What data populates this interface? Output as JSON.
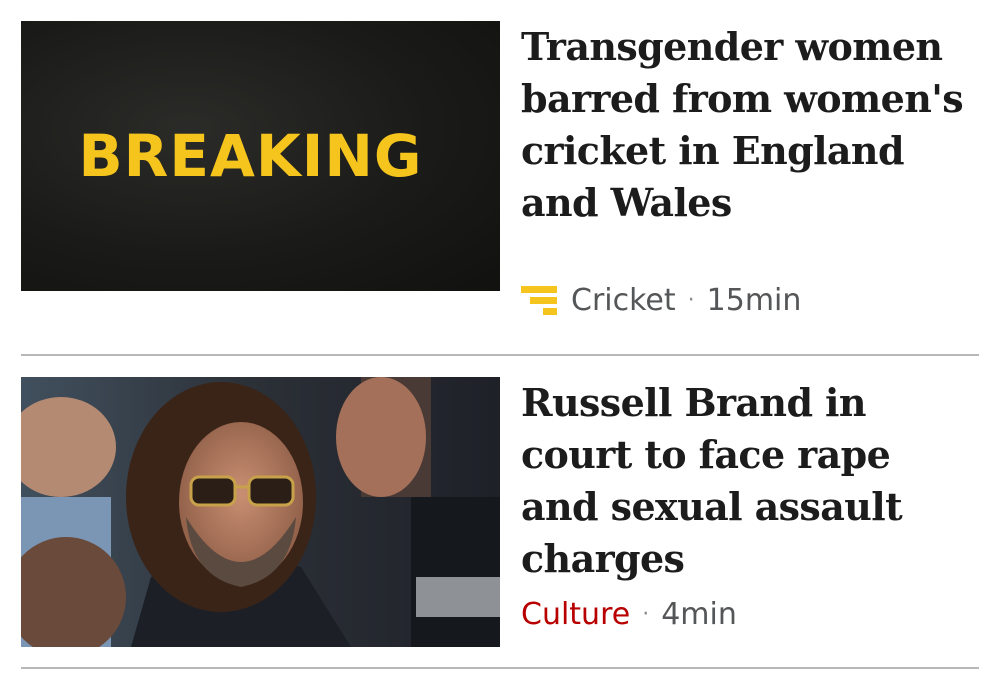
{
  "stories": [
    {
      "thumbnail_text": "BREAKING",
      "headline": "Transgender women barred from women's cricket in England and Wales",
      "section": "Cricket",
      "section_icon": "sport-icon",
      "separator": "·",
      "time": "15min"
    },
    {
      "headline": "Russell Brand in court to face rape and sexual assault charges",
      "section": "Culture",
      "separator": "·",
      "time": "4min"
    }
  ],
  "colors": {
    "breaking_yellow": "#f5c51e",
    "sport_icon_yellow": "#f5c51e",
    "culture_red": "#b80000",
    "headline": "#1c1c1c",
    "meta_grey": "#545658",
    "divider": "#b8b8b8"
  }
}
